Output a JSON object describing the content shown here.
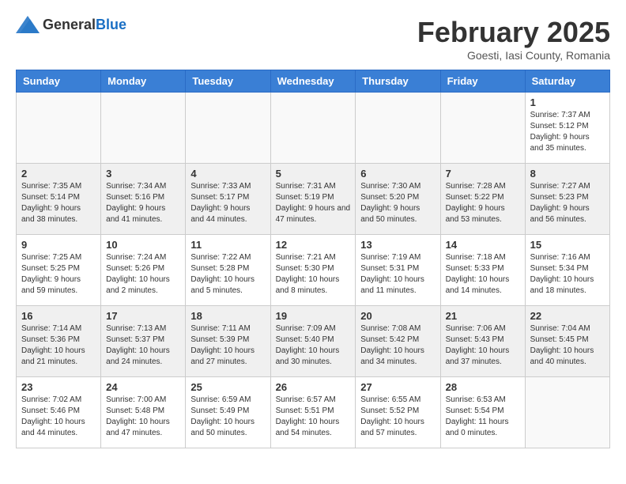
{
  "header": {
    "logo": {
      "general": "General",
      "blue": "Blue"
    },
    "title": "February 2025",
    "location": "Goesti, Iasi County, Romania"
  },
  "weekdays": [
    "Sunday",
    "Monday",
    "Tuesday",
    "Wednesday",
    "Thursday",
    "Friday",
    "Saturday"
  ],
  "weeks": [
    [
      {
        "day": "",
        "info": ""
      },
      {
        "day": "",
        "info": ""
      },
      {
        "day": "",
        "info": ""
      },
      {
        "day": "",
        "info": ""
      },
      {
        "day": "",
        "info": ""
      },
      {
        "day": "",
        "info": ""
      },
      {
        "day": "1",
        "info": "Sunrise: 7:37 AM\nSunset: 5:12 PM\nDaylight: 9 hours and 35 minutes."
      }
    ],
    [
      {
        "day": "2",
        "info": "Sunrise: 7:35 AM\nSunset: 5:14 PM\nDaylight: 9 hours and 38 minutes."
      },
      {
        "day": "3",
        "info": "Sunrise: 7:34 AM\nSunset: 5:16 PM\nDaylight: 9 hours and 41 minutes."
      },
      {
        "day": "4",
        "info": "Sunrise: 7:33 AM\nSunset: 5:17 PM\nDaylight: 9 hours and 44 minutes."
      },
      {
        "day": "5",
        "info": "Sunrise: 7:31 AM\nSunset: 5:19 PM\nDaylight: 9 hours and 47 minutes."
      },
      {
        "day": "6",
        "info": "Sunrise: 7:30 AM\nSunset: 5:20 PM\nDaylight: 9 hours and 50 minutes."
      },
      {
        "day": "7",
        "info": "Sunrise: 7:28 AM\nSunset: 5:22 PM\nDaylight: 9 hours and 53 minutes."
      },
      {
        "day": "8",
        "info": "Sunrise: 7:27 AM\nSunset: 5:23 PM\nDaylight: 9 hours and 56 minutes."
      }
    ],
    [
      {
        "day": "9",
        "info": "Sunrise: 7:25 AM\nSunset: 5:25 PM\nDaylight: 9 hours and 59 minutes."
      },
      {
        "day": "10",
        "info": "Sunrise: 7:24 AM\nSunset: 5:26 PM\nDaylight: 10 hours and 2 minutes."
      },
      {
        "day": "11",
        "info": "Sunrise: 7:22 AM\nSunset: 5:28 PM\nDaylight: 10 hours and 5 minutes."
      },
      {
        "day": "12",
        "info": "Sunrise: 7:21 AM\nSunset: 5:30 PM\nDaylight: 10 hours and 8 minutes."
      },
      {
        "day": "13",
        "info": "Sunrise: 7:19 AM\nSunset: 5:31 PM\nDaylight: 10 hours and 11 minutes."
      },
      {
        "day": "14",
        "info": "Sunrise: 7:18 AM\nSunset: 5:33 PM\nDaylight: 10 hours and 14 minutes."
      },
      {
        "day": "15",
        "info": "Sunrise: 7:16 AM\nSunset: 5:34 PM\nDaylight: 10 hours and 18 minutes."
      }
    ],
    [
      {
        "day": "16",
        "info": "Sunrise: 7:14 AM\nSunset: 5:36 PM\nDaylight: 10 hours and 21 minutes."
      },
      {
        "day": "17",
        "info": "Sunrise: 7:13 AM\nSunset: 5:37 PM\nDaylight: 10 hours and 24 minutes."
      },
      {
        "day": "18",
        "info": "Sunrise: 7:11 AM\nSunset: 5:39 PM\nDaylight: 10 hours and 27 minutes."
      },
      {
        "day": "19",
        "info": "Sunrise: 7:09 AM\nSunset: 5:40 PM\nDaylight: 10 hours and 30 minutes."
      },
      {
        "day": "20",
        "info": "Sunrise: 7:08 AM\nSunset: 5:42 PM\nDaylight: 10 hours and 34 minutes."
      },
      {
        "day": "21",
        "info": "Sunrise: 7:06 AM\nSunset: 5:43 PM\nDaylight: 10 hours and 37 minutes."
      },
      {
        "day": "22",
        "info": "Sunrise: 7:04 AM\nSunset: 5:45 PM\nDaylight: 10 hours and 40 minutes."
      }
    ],
    [
      {
        "day": "23",
        "info": "Sunrise: 7:02 AM\nSunset: 5:46 PM\nDaylight: 10 hours and 44 minutes."
      },
      {
        "day": "24",
        "info": "Sunrise: 7:00 AM\nSunset: 5:48 PM\nDaylight: 10 hours and 47 minutes."
      },
      {
        "day": "25",
        "info": "Sunrise: 6:59 AM\nSunset: 5:49 PM\nDaylight: 10 hours and 50 minutes."
      },
      {
        "day": "26",
        "info": "Sunrise: 6:57 AM\nSunset: 5:51 PM\nDaylight: 10 hours and 54 minutes."
      },
      {
        "day": "27",
        "info": "Sunrise: 6:55 AM\nSunset: 5:52 PM\nDaylight: 10 hours and 57 minutes."
      },
      {
        "day": "28",
        "info": "Sunrise: 6:53 AM\nSunset: 5:54 PM\nDaylight: 11 hours and 0 minutes."
      },
      {
        "day": "",
        "info": ""
      }
    ]
  ]
}
